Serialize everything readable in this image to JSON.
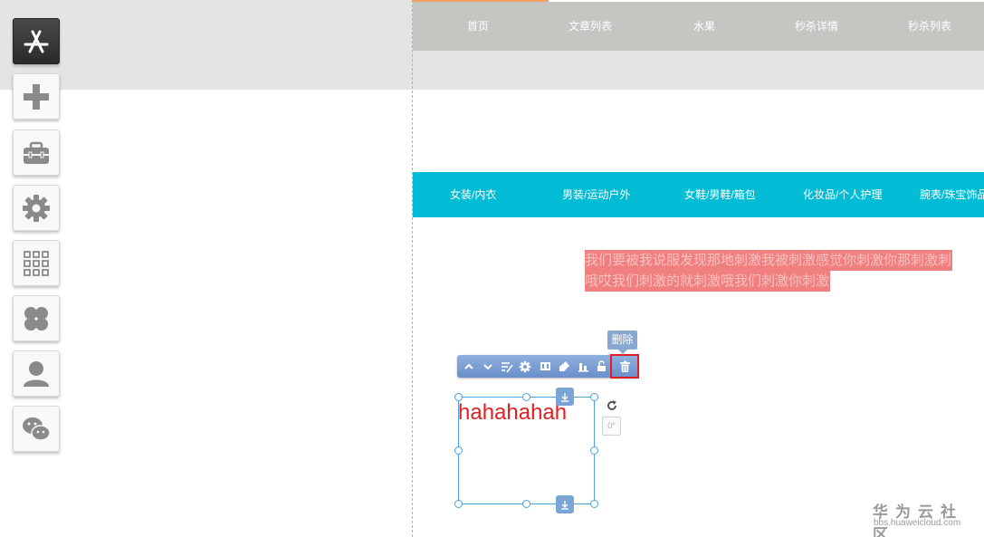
{
  "top_nav": {
    "items": [
      "首页",
      "文章列表",
      "水果",
      "秒杀详情",
      "秒杀列表"
    ]
  },
  "category_bar": {
    "items": [
      "女装/内衣",
      "男装/运动户外",
      "女鞋/男鞋/箱包",
      "化妆品/个人护理",
      "腕表/珠宝饰品"
    ],
    "color": "#00bcd4"
  },
  "highlighted_text": {
    "line1": "我们要被我说服发现那地刺激我被刺激感觉你刺激你那刺激刺",
    "line2": "哦哎我们刺激的就刺激哦我们刺激你刺激"
  },
  "delete_tooltip": "删除",
  "selected_element": {
    "text": "hahahahah",
    "angle": "0°"
  },
  "watermark": {
    "title": "华为云社区",
    "url": "bbs.huaweicloud.com"
  },
  "colors": {
    "accent_orange": "#f0a060",
    "selection_blue": "#4aa3df",
    "toolbar_blue": "#7aa3d6",
    "highlight_red": "#e02020"
  }
}
